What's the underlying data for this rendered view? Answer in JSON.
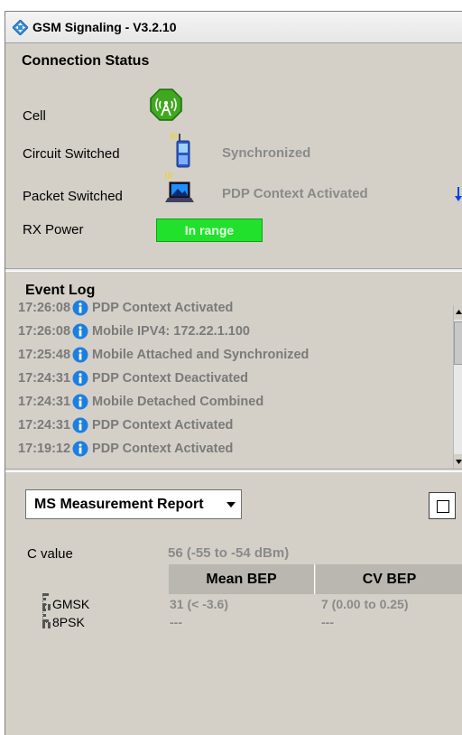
{
  "window": {
    "title": "GSM Signaling",
    "version": " - V3.2.10"
  },
  "connection_status": {
    "heading": "Connection Status",
    "rows": [
      {
        "label": "Cell",
        "status": ""
      },
      {
        "label": "Circuit Switched",
        "status": "Synchronized"
      },
      {
        "label": "Packet Switched",
        "status": "PDP Context Activated"
      },
      {
        "label": "RX Power",
        "status": "In range"
      }
    ],
    "rx_power_color": "#21e12c"
  },
  "event_log": {
    "heading": "Event Log",
    "entries": [
      {
        "time": "17:26:08",
        "message": "PDP Context Activated"
      },
      {
        "time": "17:26:08",
        "message": "Mobile IPV4: 172.22.1.100"
      },
      {
        "time": "17:25:48",
        "message": "Mobile Attached and Synchronized"
      },
      {
        "time": "17:24:31",
        "message": "PDP Context Deactivated"
      },
      {
        "time": "17:24:31",
        "message": "Mobile Detached Combined"
      },
      {
        "time": "17:24:31",
        "message": "PDP Context Activated"
      },
      {
        "time": "17:19:12",
        "message": "PDP Context Activated"
      }
    ]
  },
  "measurement": {
    "report_select": "MS Measurement Report",
    "c_value_label": "C value",
    "c_value": "56 (-55 to -54 dBm)",
    "columns": [
      "Mean BEP",
      "CV BEP"
    ],
    "rows": [
      {
        "modulation": "GMSK",
        "mean_bep": "31 (< -3.6)",
        "cv_bep": "7 (0.00 to 0.25)"
      },
      {
        "modulation": "8PSK",
        "mean_bep": "---",
        "cv_bep": "---"
      }
    ]
  },
  "icons": {
    "title": "diamond-arrows-icon",
    "cell": "cell-tower-icon",
    "circuit": "mobile-phone-icon",
    "packet": "laptop-icon",
    "log_info": "info-icon",
    "packet_scroll": "down-arrow-icon"
  }
}
